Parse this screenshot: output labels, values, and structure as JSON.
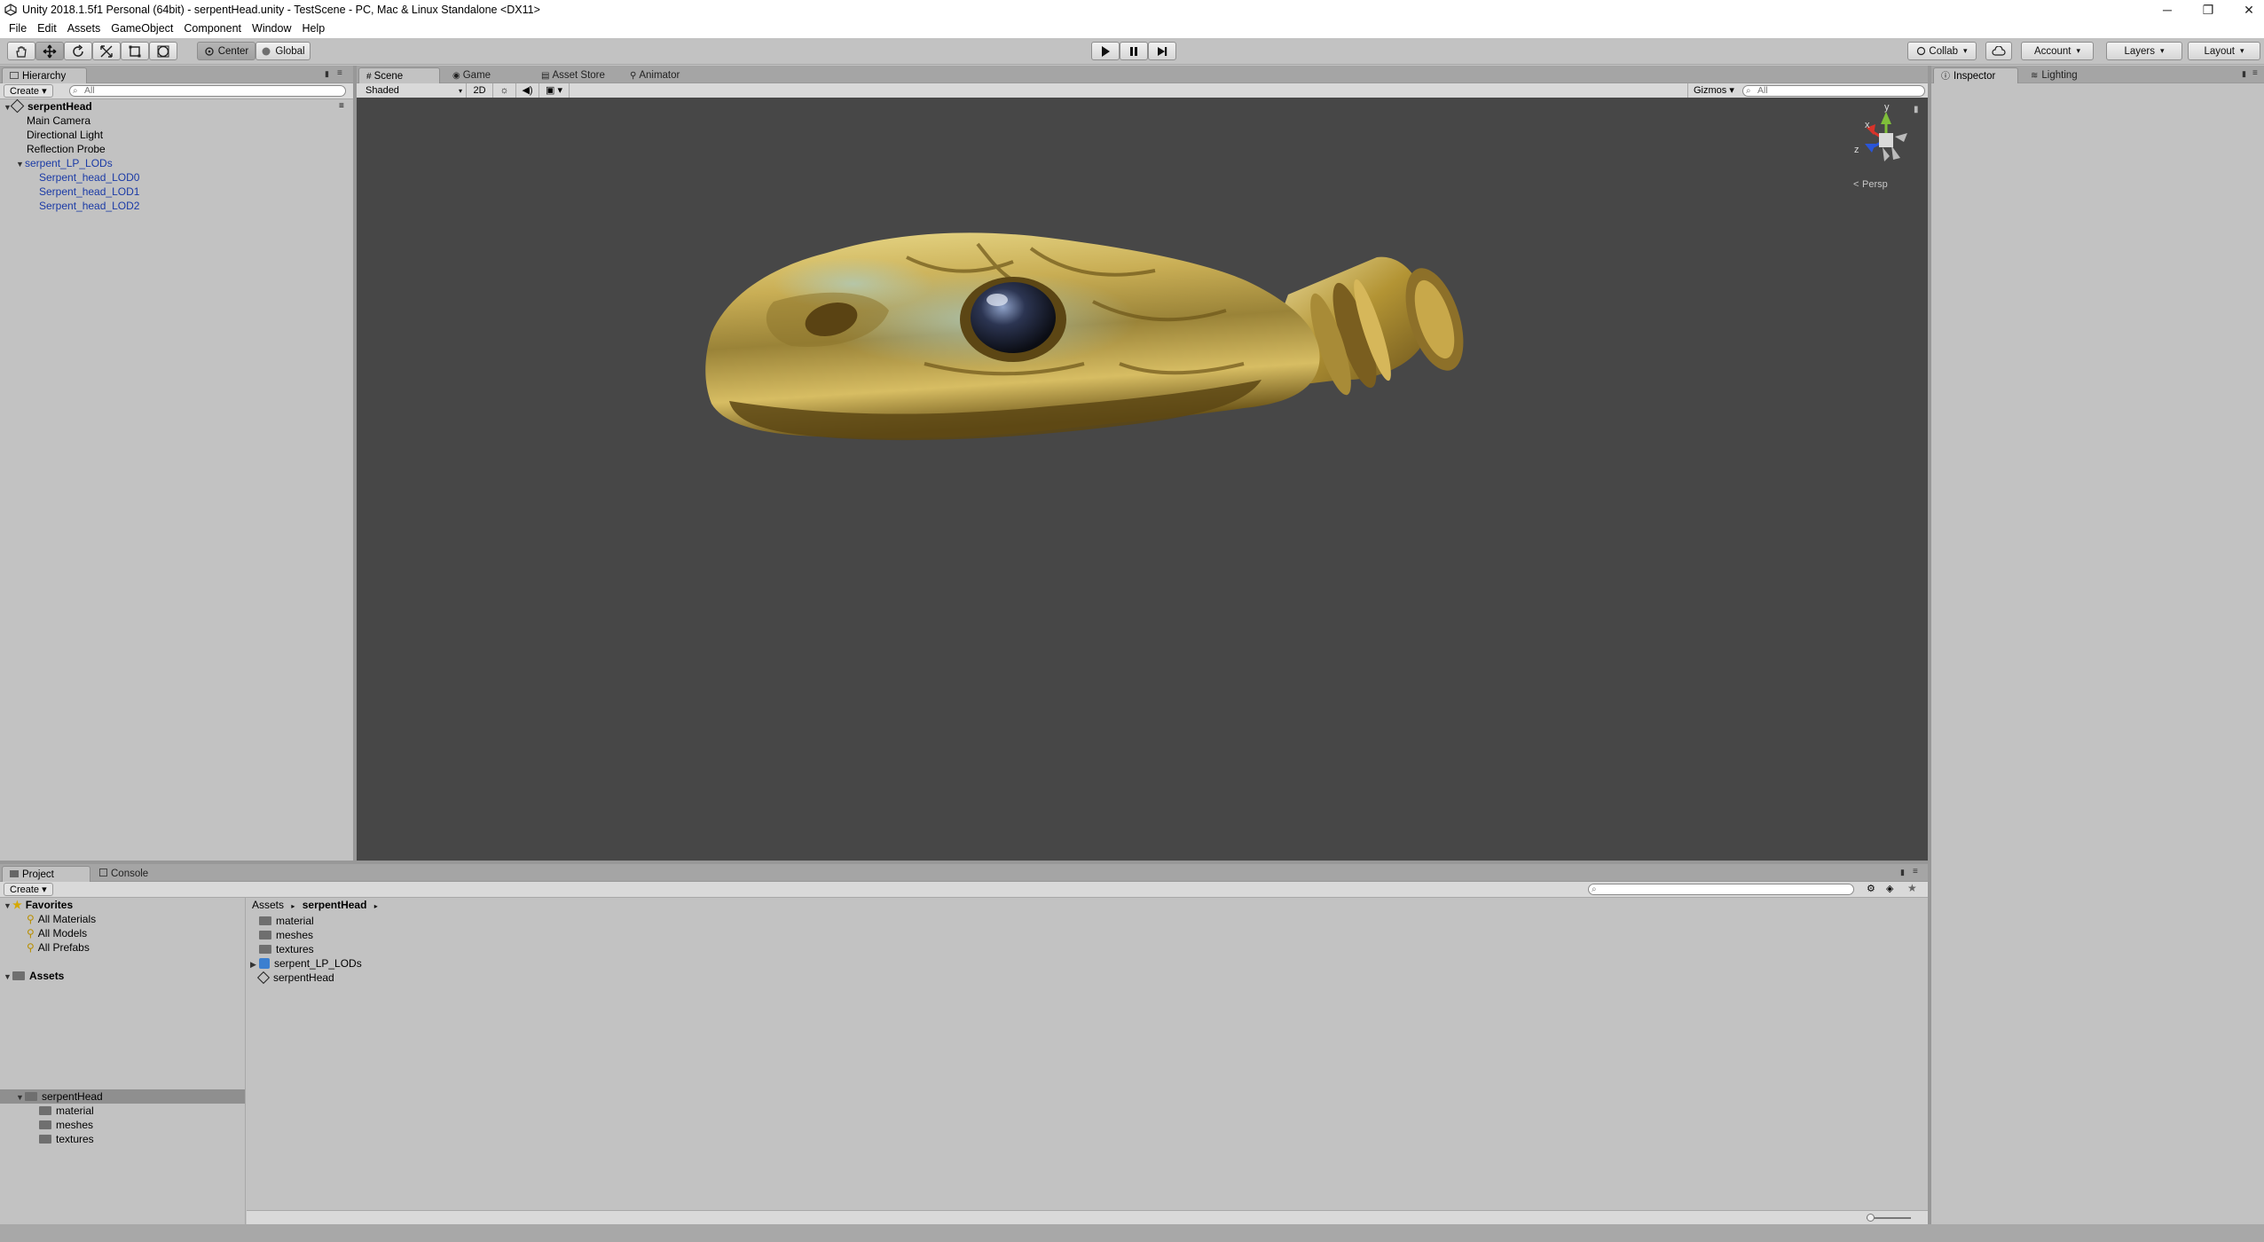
{
  "titlebar": {
    "title": "Unity 2018.1.5f1 Personal (64bit) - serpentHead.unity - TestScene - PC, Mac & Linux Standalone <DX11>",
    "minimize": "─",
    "restore": "❐",
    "close": "✕"
  },
  "menubar": {
    "items": [
      "File",
      "Edit",
      "Assets",
      "GameObject",
      "Component",
      "Window",
      "Help"
    ]
  },
  "toolbar": {
    "pivot_label": "Center",
    "space_label": "Global",
    "collab_label": "Collab",
    "account_label": "Account",
    "layers_label": "Layers",
    "layout_label": "Layout"
  },
  "hierarchy": {
    "tab_label": "Hierarchy",
    "create_label": "Create",
    "search_placeholder": "All",
    "scene_name": "serpentHead",
    "items": [
      {
        "label": "Main Camera"
      },
      {
        "label": "Directional Light"
      },
      {
        "label": "Reflection Probe"
      },
      {
        "label": "serpent_LP_LODs"
      },
      {
        "label": "Serpent_head_LOD0"
      },
      {
        "label": "Serpent_head_LOD1"
      },
      {
        "label": "Serpent_head_LOD2"
      }
    ]
  },
  "scene": {
    "tabs": [
      {
        "label": "Scene"
      },
      {
        "label": "Game"
      },
      {
        "label": "Asset Store"
      },
      {
        "label": "Animator"
      }
    ],
    "shading_mode": "Shaded",
    "mode_2d": "2D",
    "gizmos_label": "Gizmos",
    "search_placeholder": "All",
    "persp_label": "Persp",
    "axis_y": "y",
    "axis_x": "x",
    "axis_z": "z",
    "background_color": "#474747",
    "model_color": "#b8993a"
  },
  "inspector": {
    "tabs": [
      {
        "label": "Inspector"
      },
      {
        "label": "Lighting"
      }
    ]
  },
  "project": {
    "tabs": [
      {
        "label": "Project"
      },
      {
        "label": "Console"
      }
    ],
    "create_label": "Create",
    "favorites_label": "Favorites",
    "favorites": [
      {
        "label": "All Materials"
      },
      {
        "label": "All Models"
      },
      {
        "label": "All Prefabs"
      }
    ],
    "assets_label": "Assets",
    "tree_root": "serpentHead",
    "tree_children": [
      {
        "label": "material"
      },
      {
        "label": "meshes"
      },
      {
        "label": "textures"
      }
    ],
    "breadcrumb": [
      "Assets",
      "serpentHead"
    ],
    "files": [
      {
        "label": "material",
        "icon": "folder-icon"
      },
      {
        "label": "meshes",
        "icon": "folder-icon"
      },
      {
        "label": "textures",
        "icon": "folder-icon"
      },
      {
        "label": "serpent_LP_LODs",
        "icon": "prefab-icon"
      },
      {
        "label": "serpentHead",
        "icon": "unity-scene-icon"
      }
    ]
  }
}
